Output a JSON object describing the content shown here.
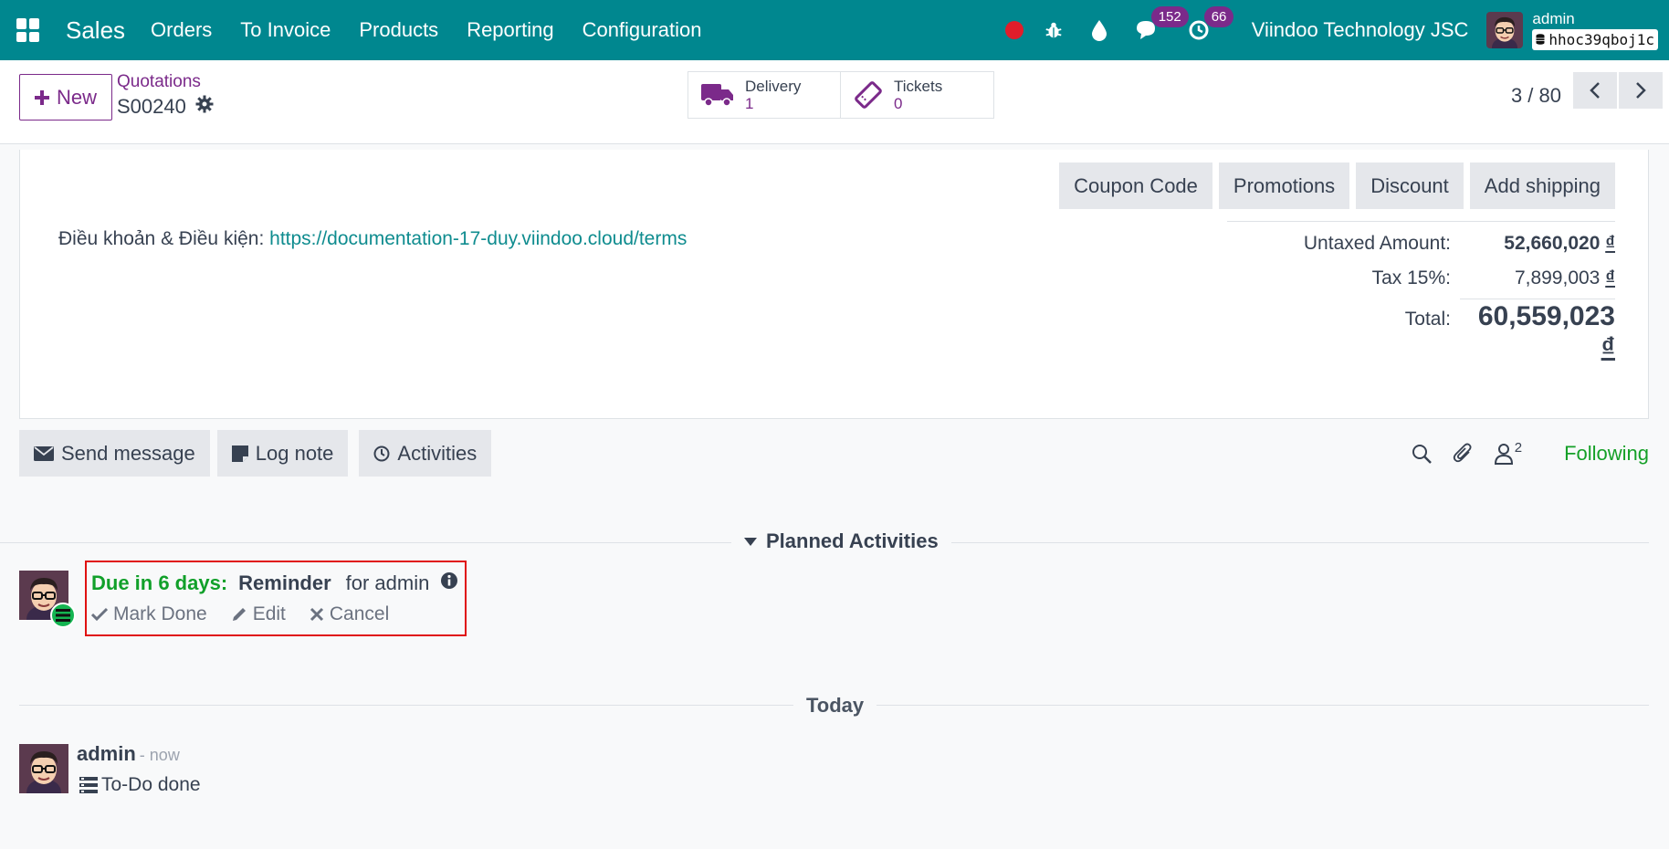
{
  "navbar": {
    "app_name": "Sales",
    "menu": [
      "Orders",
      "To Invoice",
      "Products",
      "Reporting",
      "Configuration"
    ],
    "messages_count": "152",
    "activities_count": "66",
    "company": "Viindoo Technology JSC",
    "user_name": "admin",
    "database": "hhoc39qboj1c"
  },
  "control_panel": {
    "new_label": "New",
    "breadcrumb_parent": "Quotations",
    "record_name": "S00240",
    "delivery_label": "Delivery",
    "delivery_count": "1",
    "tickets_label": "Tickets",
    "tickets_count": "0",
    "pager": "3 / 80"
  },
  "form": {
    "buttons": [
      "Coupon Code",
      "Promotions",
      "Discount",
      "Add shipping"
    ],
    "terms_label": "Điều khoản & Điều kiện: ",
    "terms_link": "https://documentation-17-duy.viindoo.cloud/terms",
    "totals": {
      "untaxed_label": "Untaxed Amount:",
      "untaxed_value": "52,660,020",
      "tax_label": "Tax 15%:",
      "tax_value": "7,899,003",
      "total_label": "Total:",
      "total_value": "60,559,023",
      "currency": "₫"
    }
  },
  "chatter": {
    "send_message": "Send message",
    "log_note": "Log note",
    "activities": "Activities",
    "followers_count": "2",
    "following": "Following",
    "planned_title": "Planned Activities",
    "activity": {
      "due": "Due in 6 days:",
      "summary": "Reminder",
      "for_user": "for admin",
      "mark_done": "Mark Done",
      "edit": "Edit",
      "cancel": "Cancel"
    },
    "today_label": "Today",
    "message": {
      "author": "admin",
      "date": "- now",
      "body": "To-Do done"
    }
  },
  "colors": {
    "navbar": "#00878f",
    "primary": "#7b2a8a",
    "success": "#15a027",
    "highlight_border": "#e01111"
  }
}
